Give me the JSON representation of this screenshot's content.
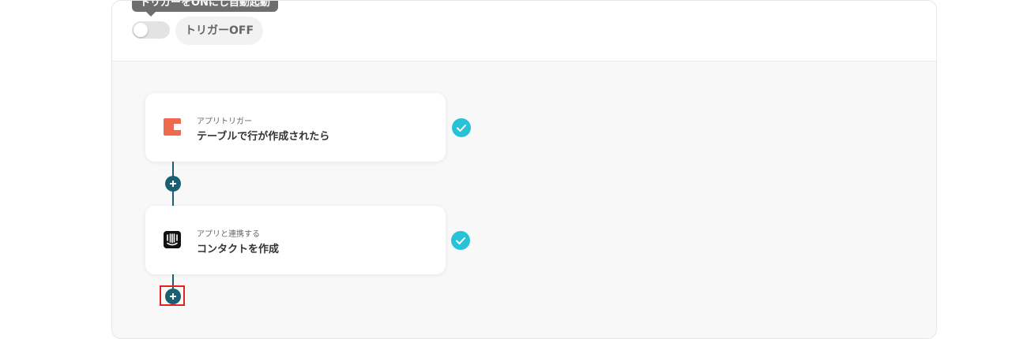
{
  "header": {
    "tooltip_text": "トリガーをONにし自動起動",
    "toggle_state": "off",
    "status_label": "トリガーOFF"
  },
  "flow": {
    "steps": [
      {
        "kind_label": "アプリトリガー",
        "title": "テーブルで行が作成されたら",
        "icon": "coda-app-icon",
        "completed": true
      },
      {
        "kind_label": "アプリと連携する",
        "title": "コンタクトを作成",
        "icon": "intercom-app-icon",
        "completed": true
      }
    ],
    "add_step_icon": "plus-icon",
    "highlighted": "add-step-button-2"
  },
  "colors": {
    "accent_dark": "#1a5e72",
    "check_teal": "#27c2d8",
    "highlight_red": "#e02424",
    "coda_orange": "#ee6a4d"
  }
}
